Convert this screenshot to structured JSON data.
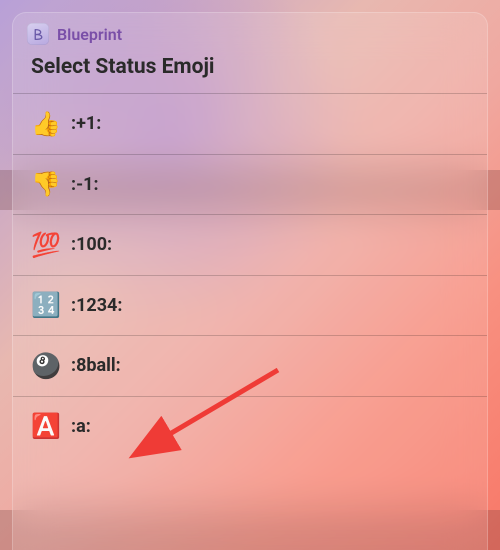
{
  "app": {
    "name": "Blueprint"
  },
  "title": "Select Status Emoji",
  "items": [
    {
      "emoji": "👍",
      "code": ":+1:"
    },
    {
      "emoji": "👎",
      "code": ":-1:"
    },
    {
      "emoji": "💯",
      "code": ":100:"
    },
    {
      "emoji": "🔢",
      "code": ":1234:"
    },
    {
      "emoji": "🎱",
      "code": ":8ball:"
    },
    {
      "emoji": "🅰️",
      "code": ":a:"
    }
  ],
  "annotation": {
    "target_index": 4
  }
}
